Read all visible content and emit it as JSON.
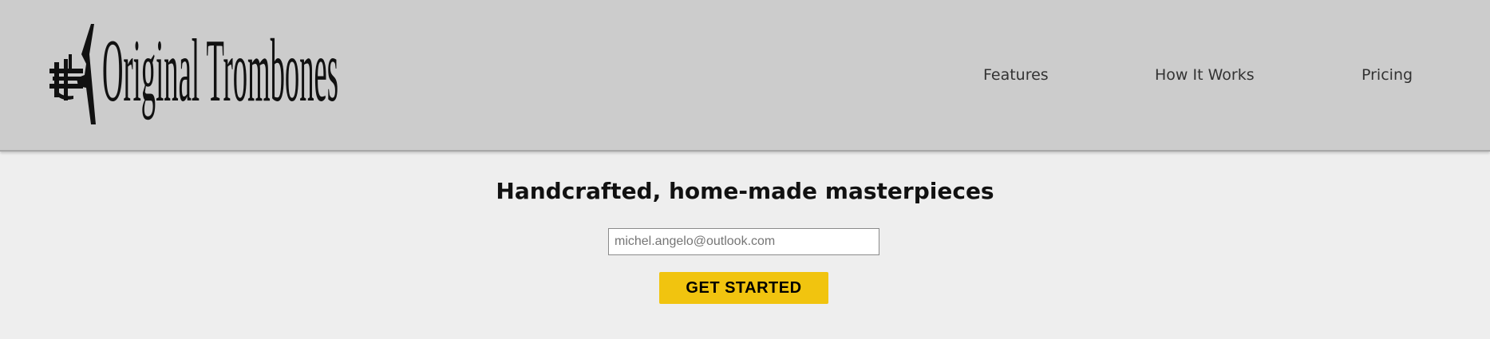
{
  "header": {
    "logo_text": "Original Trombones",
    "background": "#cccccc"
  },
  "nav": {
    "items": [
      {
        "label": "Features"
      },
      {
        "label": "How It Works"
      },
      {
        "label": "Pricing"
      }
    ]
  },
  "hero": {
    "title": "Handcrafted, home-made masterpieces",
    "email_placeholder": "michel.angelo@outlook.com",
    "cta_label": "GET STARTED",
    "cta_color": "#f1c40f"
  },
  "icons": {
    "logo_mark": "trombone-icon"
  }
}
